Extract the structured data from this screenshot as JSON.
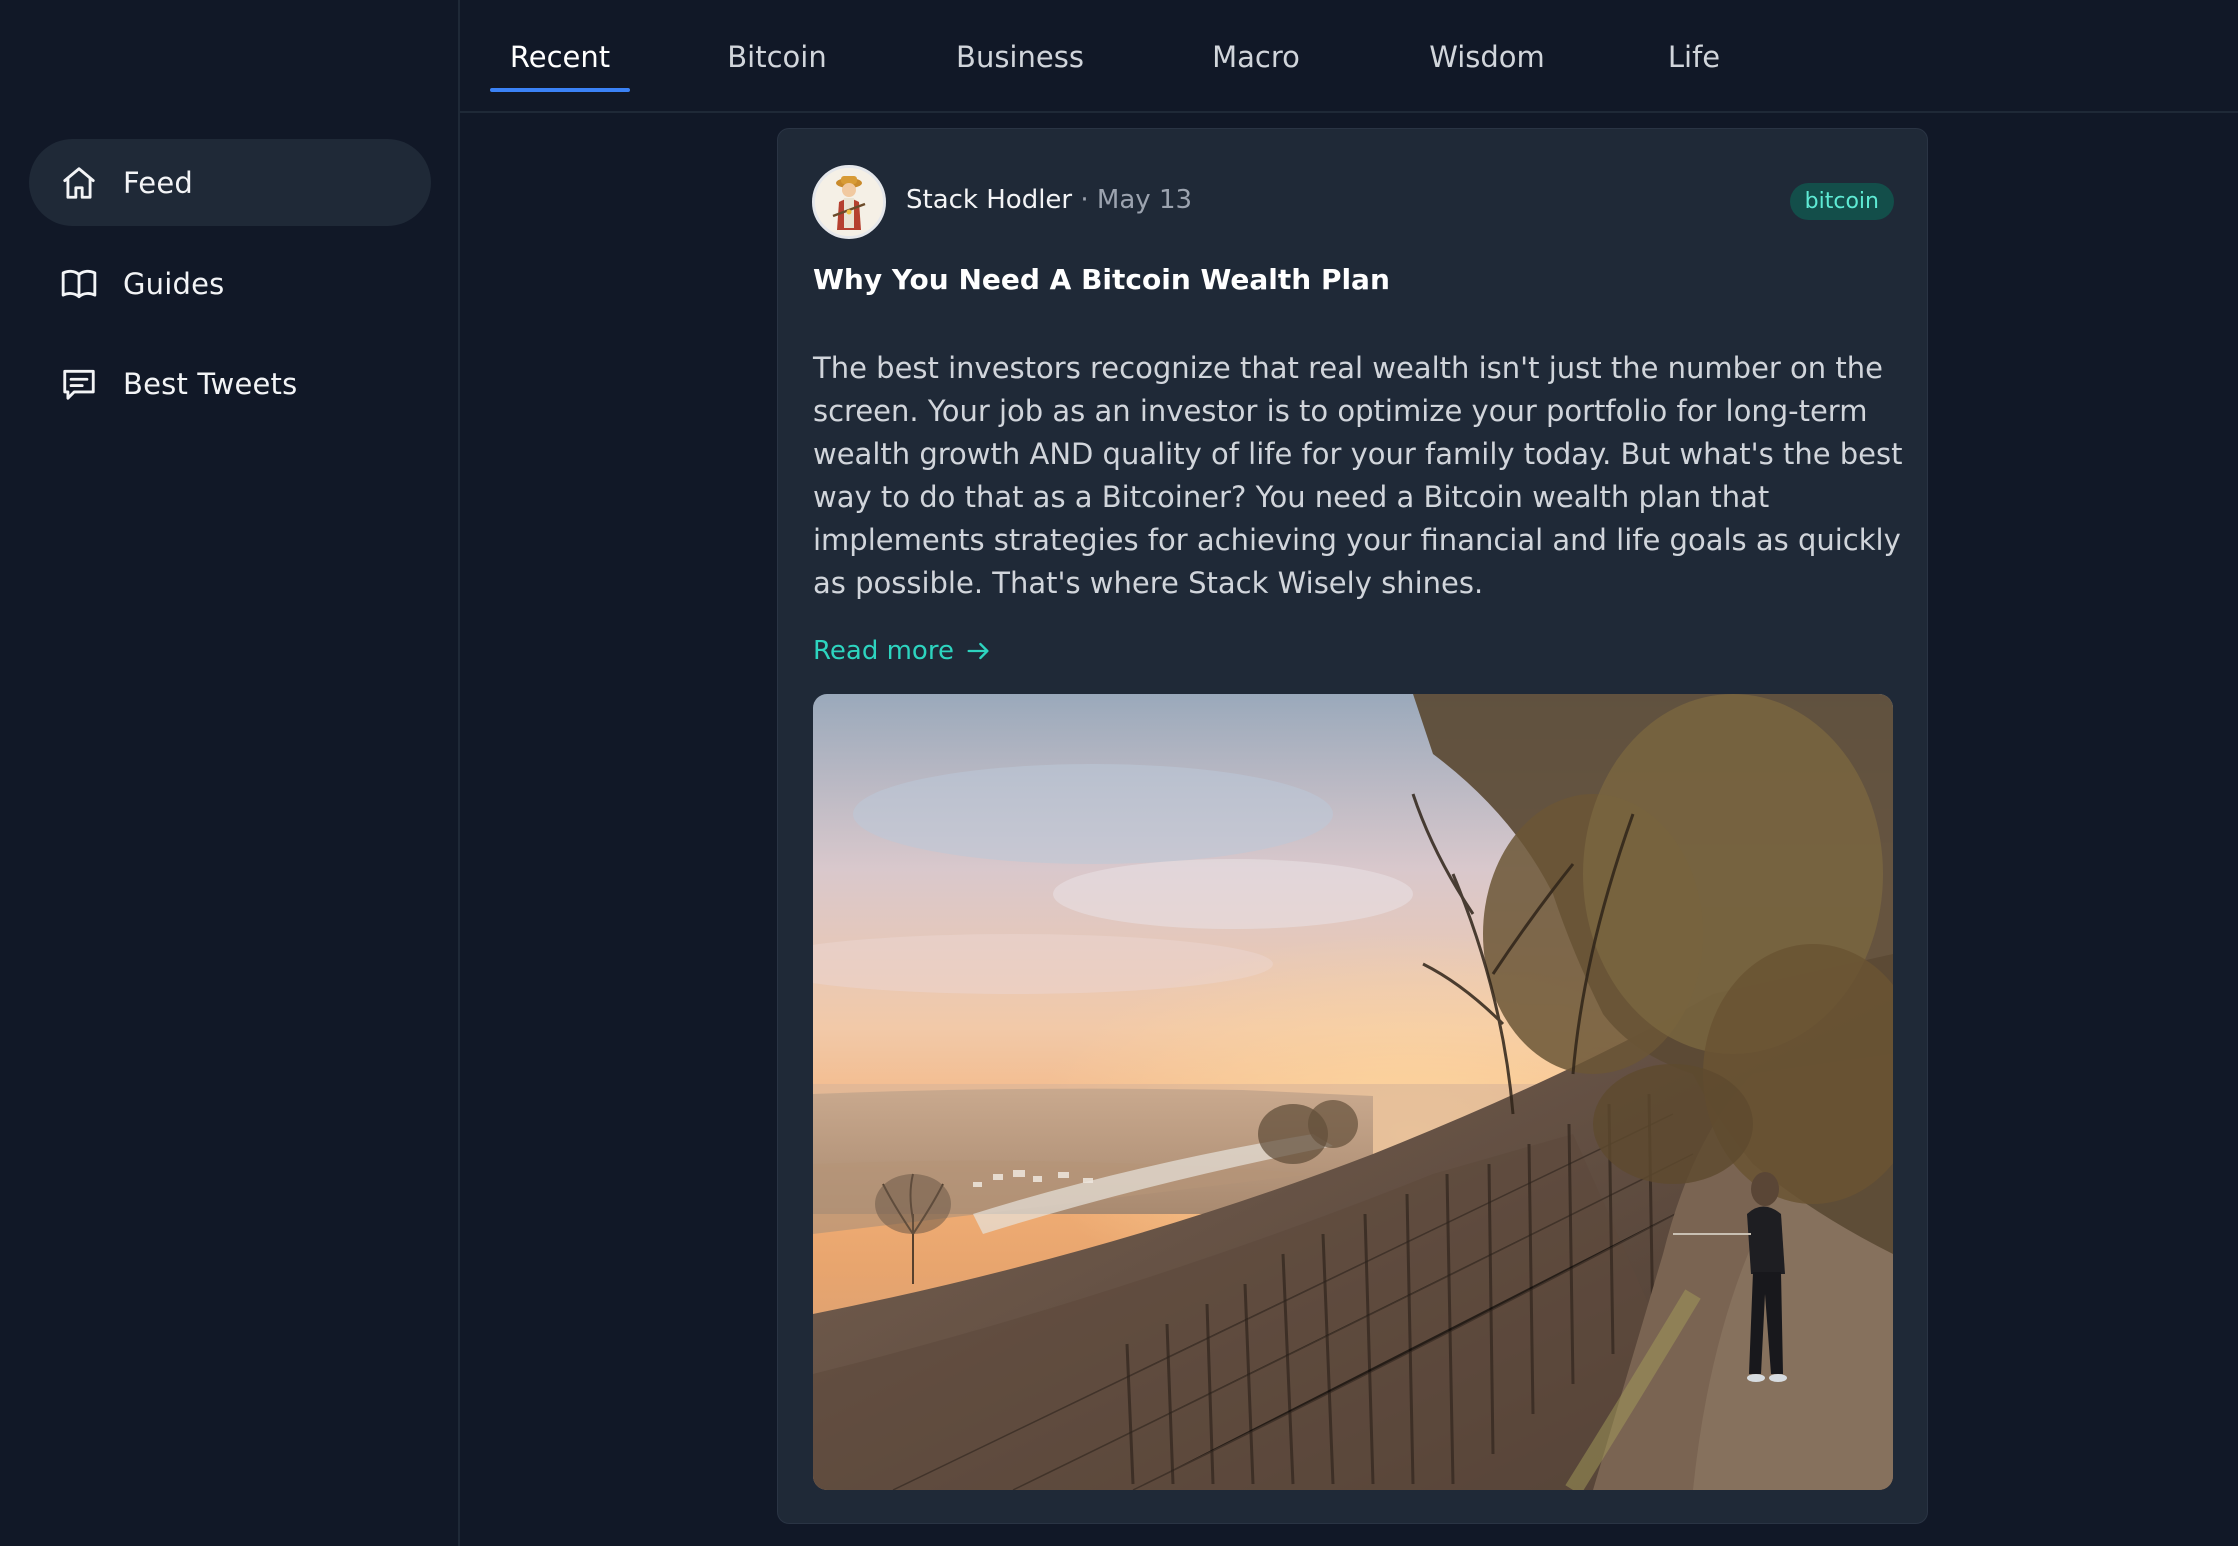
{
  "sidebar": {
    "items": [
      {
        "label": "Feed",
        "icon": "home-icon",
        "active": true
      },
      {
        "label": "Guides",
        "icon": "book-icon",
        "active": false
      },
      {
        "label": "Best Tweets",
        "icon": "chat-icon",
        "active": false
      }
    ]
  },
  "tabs": [
    {
      "label": "Recent",
      "active": true
    },
    {
      "label": "Bitcoin",
      "active": false
    },
    {
      "label": "Business",
      "active": false
    },
    {
      "label": "Macro",
      "active": false
    },
    {
      "label": "Wisdom",
      "active": false
    },
    {
      "label": "Life",
      "active": false
    }
  ],
  "post": {
    "author": "Stack Hodler",
    "separator": "·",
    "date": "May 13",
    "tag": "bitcoin",
    "title": "Why You Need A Bitcoin Wealth Plan",
    "body": "The best investors recognize that real wealth isn't just the number on the screen. Your job as an investor is to optimize your portfolio for long-term wealth growth AND quality of life for your family today. But what's the best way to do that as a Bitcoiner? You need a Bitcoin wealth plan that implements strategies for achieving your financial and life goals as quickly as possible. That's where Stack Wisely shines.",
    "read_more": "Read more",
    "image_subject": "sunset over hillside vineyard with a person standing among the vines"
  },
  "colors": {
    "background": "#111827",
    "surface": "#1f2937",
    "tab_underline": "#3b82f6",
    "accent_teal": "#2dd4bf",
    "tag_bg": "#134e4a",
    "tag_text": "#5eead4"
  }
}
